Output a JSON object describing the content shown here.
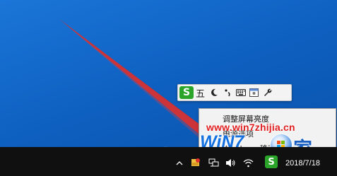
{
  "ime_toolbar": {
    "logo": "S",
    "mode_label": "五",
    "icons": [
      "moon-icon",
      "punctuation-icon",
      "keyboard-icon",
      "user-icon",
      "wrench-icon"
    ]
  },
  "context_menu": {
    "items": [
      {
        "label": "调整屏幕亮度"
      },
      {
        "label": "电源选项"
      },
      {
        "label": "Windows 移动中心"
      }
    ]
  },
  "watermark": {
    "url": "www.win7zhijia.cn",
    "logo_text": "WiN7",
    "logo_cn": "家"
  },
  "taskbar": {
    "clock_date": "2018/7/18",
    "tray_logo": "S"
  },
  "colors": {
    "desktop": "#1265c4",
    "taskbar": "#101010",
    "pointer_red": "#d42a2a",
    "ime_green": "#2aa52a"
  }
}
